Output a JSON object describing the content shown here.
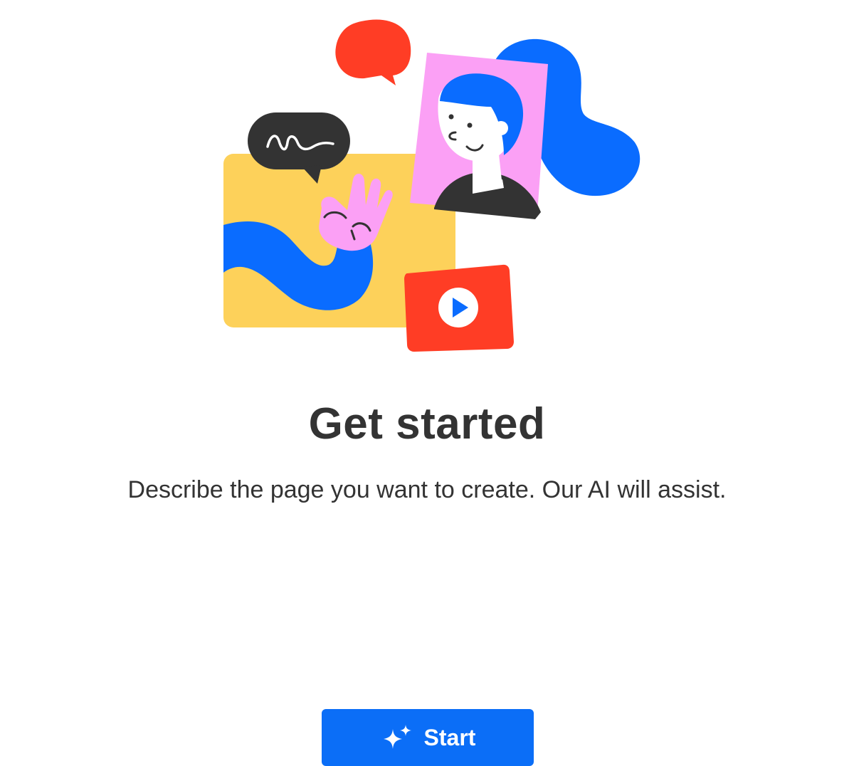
{
  "main": {
    "title": "Get started",
    "subtitle": "Describe the page you want to create. Our AI will assist.",
    "start_button": {
      "label": "Start",
      "icon": "sparkles-icon"
    }
  },
  "colors": {
    "accent": "#0b6ef7",
    "text": "#333333",
    "yellow": "#fdd15a",
    "red": "#ff3d25",
    "pink": "#fba0f5",
    "blue": "#0a6cff",
    "dark": "#333333"
  }
}
